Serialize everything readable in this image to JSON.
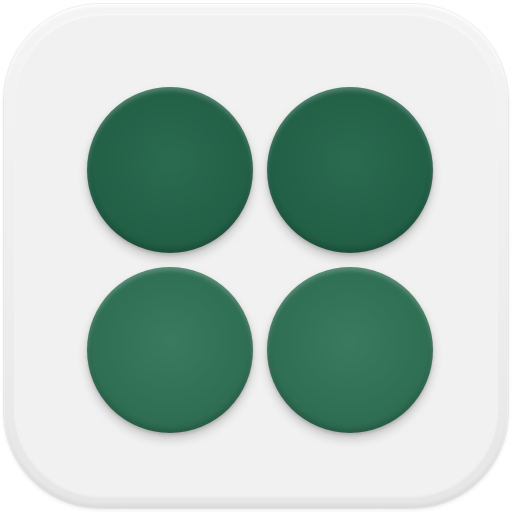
{
  "icon": {
    "name": "four-dots-app-icon",
    "background_color": "#efefef",
    "dot_color": "#236148",
    "dot_color_light": "#307055",
    "dots": [
      {
        "id": "top-left"
      },
      {
        "id": "top-right"
      },
      {
        "id": "bottom-left"
      },
      {
        "id": "bottom-right"
      }
    ]
  }
}
